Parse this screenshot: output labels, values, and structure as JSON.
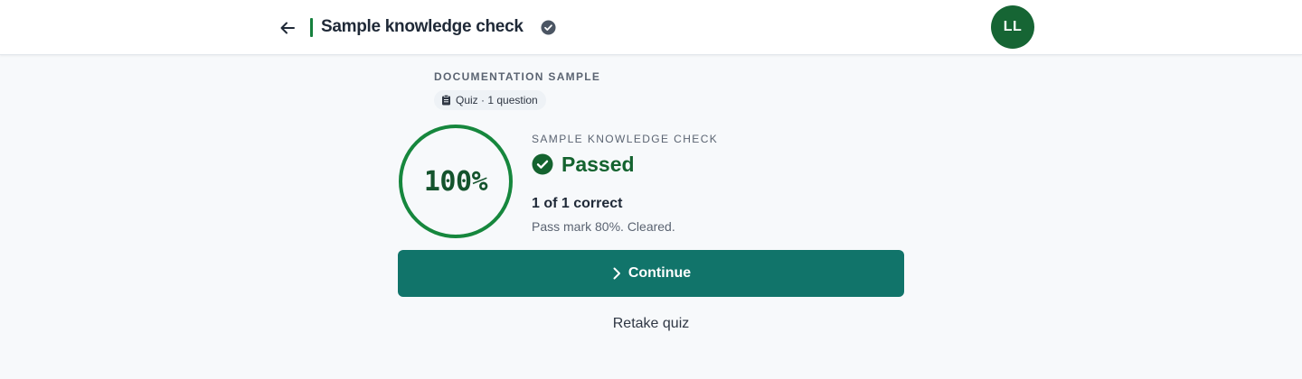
{
  "header": {
    "title": "Sample knowledge check",
    "back_icon": "arrow-left-icon",
    "verified_icon": "check-circle-icon",
    "avatar_initials": "LL"
  },
  "course": {
    "section_label": "DOCUMENTATION SAMPLE",
    "pill_icon": "clipboard-icon",
    "pill_text": "Quiz · 1 question"
  },
  "result": {
    "score_percent": "100%",
    "score_fraction": 1.0,
    "quiz_label": "SAMPLE KNOWLEDGE CHECK",
    "status": "Passed",
    "status_icon": "check-circle-icon",
    "correct_summary": "1 of 1 correct",
    "pass_note": "Pass mark 80%. Cleared."
  },
  "actions": {
    "continue_label": "Continue",
    "continue_icon": "chevron-right-icon",
    "retake_label": "Retake quiz"
  },
  "colors": {
    "accent_teal": "#11746a",
    "success_green": "#15803d",
    "ring_green": "#16873d",
    "avatar_green": "#166534",
    "page_bg": "#f7f9fb"
  }
}
